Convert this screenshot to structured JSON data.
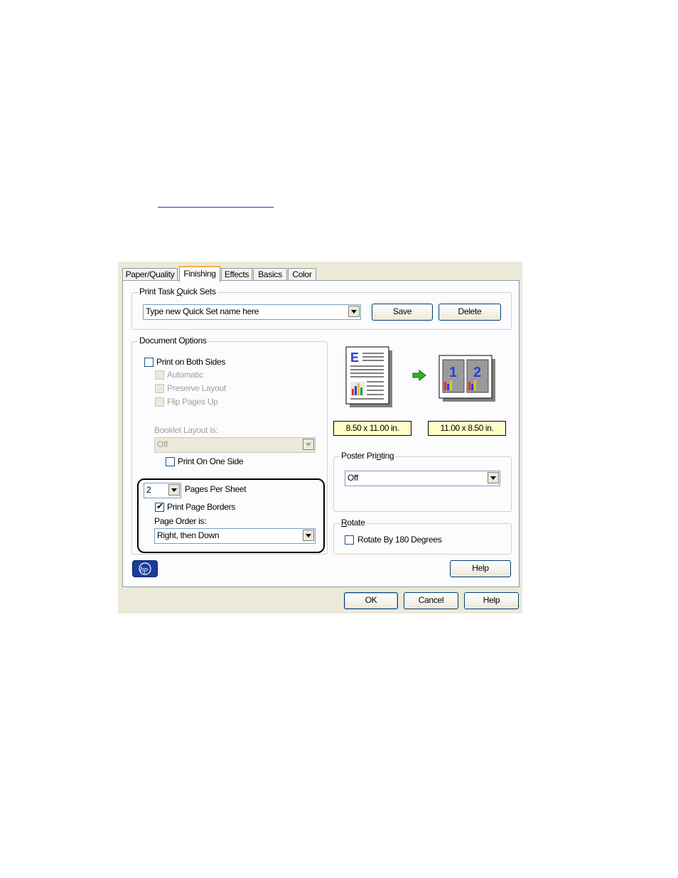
{
  "tabs": [
    "Paper/Quality",
    "Finishing",
    "Effects",
    "Basics",
    "Color"
  ],
  "active_tab": "Finishing",
  "quick_sets": {
    "label": "Print Task Quick Sets",
    "value": "Type new Quick Set name here",
    "save_label": "Save",
    "delete_label": "Delete"
  },
  "document_options": {
    "label": "Document Options",
    "print_both_sides": "Print on Both Sides",
    "automatic": "Automatic",
    "preserve_layout": "Preserve Layout",
    "flip_pages_up": "Flip Pages Up",
    "booklet_label": "Booklet Layout is:",
    "booklet_value": "Off",
    "print_one_side": "Print On One Side",
    "pages_per_sheet_value": "2",
    "pages_per_sheet_label": "Pages Per Sheet",
    "print_page_borders": "Print Page Borders",
    "print_page_borders_checked": true,
    "page_order_label": "Page Order is:",
    "page_order_value": "Right, then Down"
  },
  "preview": {
    "source_size": "8.50 x 11.00 in.",
    "target_size": "11.00 x 8.50 in.",
    "page_letter": "E",
    "page_numbers": [
      "1",
      "2"
    ]
  },
  "poster": {
    "label": "Poster Printing",
    "value": "Off"
  },
  "rotate": {
    "label": "Rotate",
    "checkbox_label": "Rotate By 180 Degrees"
  },
  "logo_text": "hp",
  "help_label": "Help",
  "footer": {
    "ok": "OK",
    "cancel": "Cancel",
    "help": "Help"
  },
  "colors": {
    "accent_tab": "#f5b041",
    "size_box": "#ffffc6",
    "arrow": "#2ab52a",
    "logo": "#1a3d9c"
  }
}
